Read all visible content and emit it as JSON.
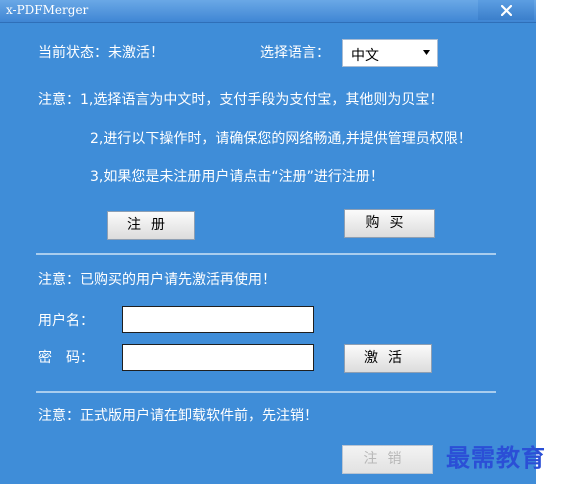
{
  "window": {
    "title": "x-PDFMerger",
    "close_symbol": "×"
  },
  "status": {
    "label": "当前状态：",
    "value": "未激活！"
  },
  "language": {
    "label": "选择语言：",
    "selected": "中文"
  },
  "notes": {
    "line1": "注意：1,选择语言为中文时，支付手段为支付宝，其他则为贝宝！",
    "line2": "2,进行以下操作时，请确保您的网络畅通,并提供管理员权限！",
    "line3": "3,如果您是未注册用户请点击“注册”进行注册！"
  },
  "buttons": {
    "register": "注册",
    "buy": "购买",
    "activate": "激活",
    "deregister": "注销"
  },
  "activation": {
    "note": "注意：已购买的用户请先激活再使用！",
    "username_label": "用户名：",
    "password_label": "密　码：",
    "username_value": "",
    "password_value": ""
  },
  "uninstall": {
    "note": "注意：正式版用户请在卸载软件前，先注销！"
  },
  "watermark": {
    "text": "最需教育"
  },
  "icons": {
    "close": "close-icon",
    "dropdown": "dropdown-arrow-icon"
  },
  "colors": {
    "panel": "#3f8dd8",
    "titlebar": "#5a9ee0",
    "watermark": "#2b4fd6",
    "divider": "#a9cdee"
  }
}
